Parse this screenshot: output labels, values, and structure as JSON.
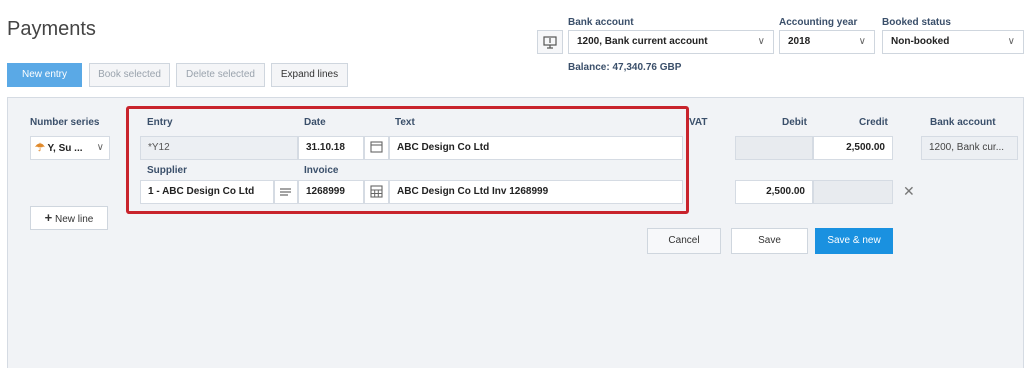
{
  "header": {
    "title": "Payments",
    "bank_account_label": "Bank account",
    "bank_account_value": "1200, Bank current account",
    "accounting_year_label": "Accounting year",
    "accounting_year_value": "2018",
    "booked_status_label": "Booked status",
    "booked_status_value": "Non-booked",
    "balance": "Balance: 47,340.76 GBP"
  },
  "toolbar": {
    "new_entry": "New entry",
    "book_selected": "Book selected",
    "delete_selected": "Delete selected",
    "expand_lines": "Expand lines"
  },
  "grid": {
    "headers": {
      "number_series": "Number series",
      "entry": "Entry",
      "date": "Date",
      "text": "Text",
      "vat": "VAT",
      "debit": "Debit",
      "credit": "Credit",
      "bank_account": "Bank account",
      "supplier": "Supplier",
      "invoice": "Invoice"
    },
    "row1": {
      "number_series": "Y, Su ...",
      "entry": "*Y12",
      "date": "31.10.18",
      "text": "ABC Design Co Ltd",
      "credit": "2,500.00",
      "bank_account": "1200, Bank cur..."
    },
    "row2": {
      "supplier": "1 - ABC Design Co Ltd",
      "invoice": "1268999",
      "text": "ABC Design Co Ltd Inv 1268999",
      "debit": "2,500.00"
    }
  },
  "actions": {
    "new_line": "New line",
    "cancel": "Cancel",
    "save": "Save",
    "save_new": "Save & new"
  },
  "colors": {
    "highlight": "#c8232c",
    "primary": "#1a91e0"
  }
}
